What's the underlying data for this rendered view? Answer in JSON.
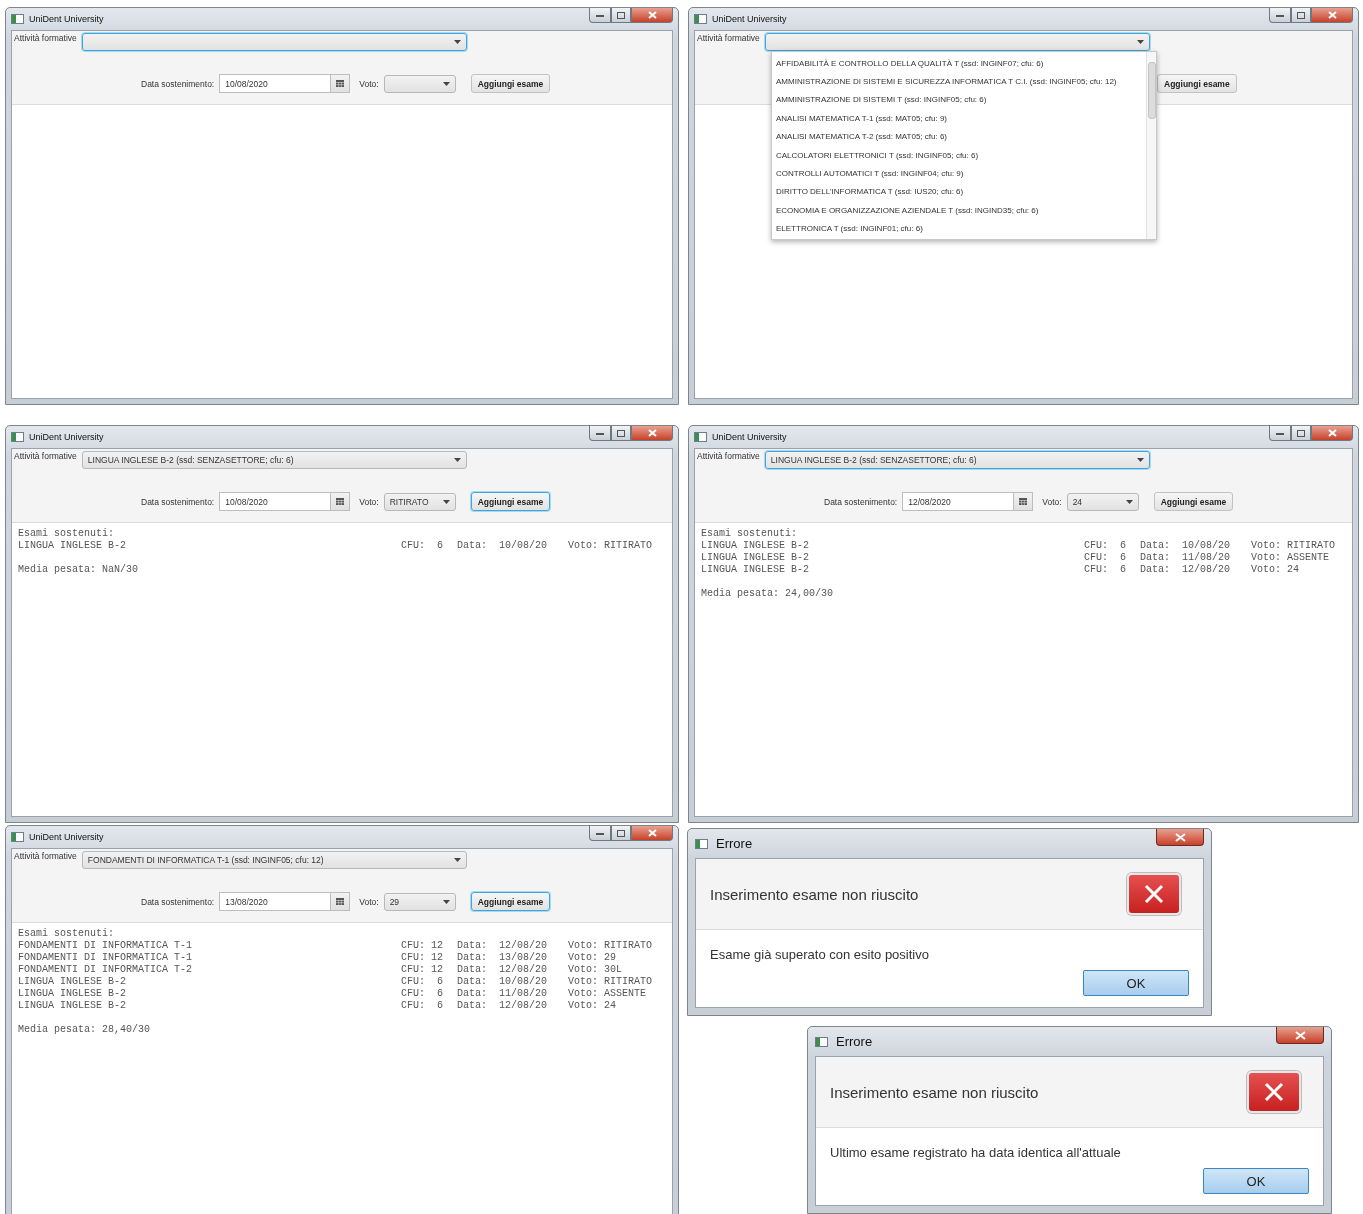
{
  "windows": [
    {
      "title": "UniDent University",
      "activity": {
        "label": "Attività formative",
        "focused": true
      },
      "date": {
        "label": "Data sostenimento:",
        "value": "10/08/2020"
      },
      "voto": {
        "label": "Voto:"
      },
      "add_button": {
        "label": "Aggiungi esame",
        "focused": false
      }
    },
    {
      "title": "UniDent University",
      "activity": {
        "label": "Attività formative",
        "focused": true
      },
      "add_button": {
        "label": "Aggiungi esame",
        "focused": false
      },
      "dropdown": [
        "AFFIDABILITÀ E CONTROLLO DELLA QUALITÀ T (ssd: INGINF07; cfu: 6)",
        "AMMINISTRAZIONE DI SISTEMI E SICUREZZA INFORMATICA T C.I. (ssd: INGINF05; cfu: 12)",
        "AMMINISTRAZIONE DI SISTEMI T (ssd: INGINF05; cfu: 6)",
        "ANALISI MATEMATICA T-1 (ssd: MAT05; cfu: 9)",
        "ANALISI MATEMATICA T-2 (ssd: MAT05; cfu: 6)",
        "CALCOLATORI ELETTRONICI T (ssd: INGINF05; cfu: 6)",
        "CONTROLLI AUTOMATICI T (ssd: INGINF04; cfu: 9)",
        "DIRITTO DELL'INFORMATICA T (ssd: IUS20; cfu: 6)",
        "ECONOMIA E ORGANIZZAZIONE AZIENDALE T (ssd: INGIND35; cfu: 6)",
        "ELETTRONICA T (ssd: INGINF01; cfu: 6)"
      ]
    },
    {
      "title": "UniDent University",
      "activity": {
        "label": "Attività formative",
        "value": "LINGUA INGLESE B-2 (ssd: SENZASETTORE; cfu: 6)",
        "focused": false
      },
      "date": {
        "label": "Data sostenimento:",
        "value": "10/08/2020"
      },
      "voto": {
        "label": "Voto:",
        "value": "RITIRATO"
      },
      "add_button": {
        "label": "Aggiungi esame",
        "focused": true
      },
      "results": {
        "heading": "Esami sostenuti:",
        "rows": [
          {
            "name": "LINGUA INGLESE B-2",
            "cfu": "CFU:  6",
            "data": "Data:  10/08/20",
            "voto": "Voto: RITIRATO"
          }
        ],
        "media": "Media pesata: NaN/30"
      }
    },
    {
      "title": "UniDent University",
      "activity": {
        "label": "Attività formative",
        "value": "LINGUA INGLESE B-2 (ssd: SENZASETTORE; cfu: 6)",
        "focused": true
      },
      "date": {
        "label": "Data sostenimento:",
        "value": "12/08/2020"
      },
      "voto": {
        "label": "Voto:",
        "value": "24"
      },
      "add_button": {
        "label": "Aggiungi esame",
        "focused": false
      },
      "results": {
        "heading": "Esami sostenuti:",
        "rows": [
          {
            "name": "LINGUA INGLESE B-2",
            "cfu": "CFU:  6",
            "data": "Data:  10/08/20",
            "voto": "Voto: RITIRATO"
          },
          {
            "name": "LINGUA INGLESE B-2",
            "cfu": "CFU:  6",
            "data": "Data:  11/08/20",
            "voto": "Voto: ASSENTE"
          },
          {
            "name": "LINGUA INGLESE B-2",
            "cfu": "CFU:  6",
            "data": "Data:  12/08/20",
            "voto": "Voto: 24"
          }
        ],
        "media": "Media pesata: 24,00/30"
      }
    },
    {
      "title": "UniDent University",
      "activity": {
        "label": "Attività formative",
        "value": "FONDAMENTI DI INFORMATICA T-1 (ssd: INGINF05; cfu: 12)",
        "focused": false
      },
      "date": {
        "label": "Data sostenimento:",
        "value": "13/08/2020"
      },
      "voto": {
        "label": "Voto:",
        "value": "29"
      },
      "add_button": {
        "label": "Aggiungi esame",
        "focused": true
      },
      "results": {
        "heading": "Esami sostenuti:",
        "rows": [
          {
            "name": "FONDAMENTI DI INFORMATICA T-1",
            "cfu": "CFU: 12",
            "data": "Data:  12/08/20",
            "voto": "Voto: RITIRATO"
          },
          {
            "name": "FONDAMENTI DI INFORMATICA T-1",
            "cfu": "CFU: 12",
            "data": "Data:  13/08/20",
            "voto": "Voto: 29"
          },
          {
            "name": "FONDAMENTI DI INFORMATICA T-2",
            "cfu": "CFU: 12",
            "data": "Data:  12/08/20",
            "voto": "Voto: 30L"
          },
          {
            "name": "LINGUA INGLESE B-2",
            "cfu": "CFU:  6",
            "data": "Data:  10/08/20",
            "voto": "Voto: RITIRATO"
          },
          {
            "name": "LINGUA INGLESE B-2",
            "cfu": "CFU:  6",
            "data": "Data:  11/08/20",
            "voto": "Voto: ASSENTE"
          },
          {
            "name": "LINGUA INGLESE B-2",
            "cfu": "CFU:  6",
            "data": "Data:  12/08/20",
            "voto": "Voto: 24"
          }
        ],
        "media": "Media pesata: 28,40/30"
      }
    }
  ],
  "dialogs": [
    {
      "title": "Errore",
      "header": "Inserimento esame non riuscito",
      "message": "Esame già superato con esito positivo",
      "ok": "OK"
    },
    {
      "title": "Errore",
      "header": "Inserimento esame non riuscito",
      "message": "Ultimo esame registrato ha data identica all'attuale",
      "ok": "OK"
    }
  ]
}
